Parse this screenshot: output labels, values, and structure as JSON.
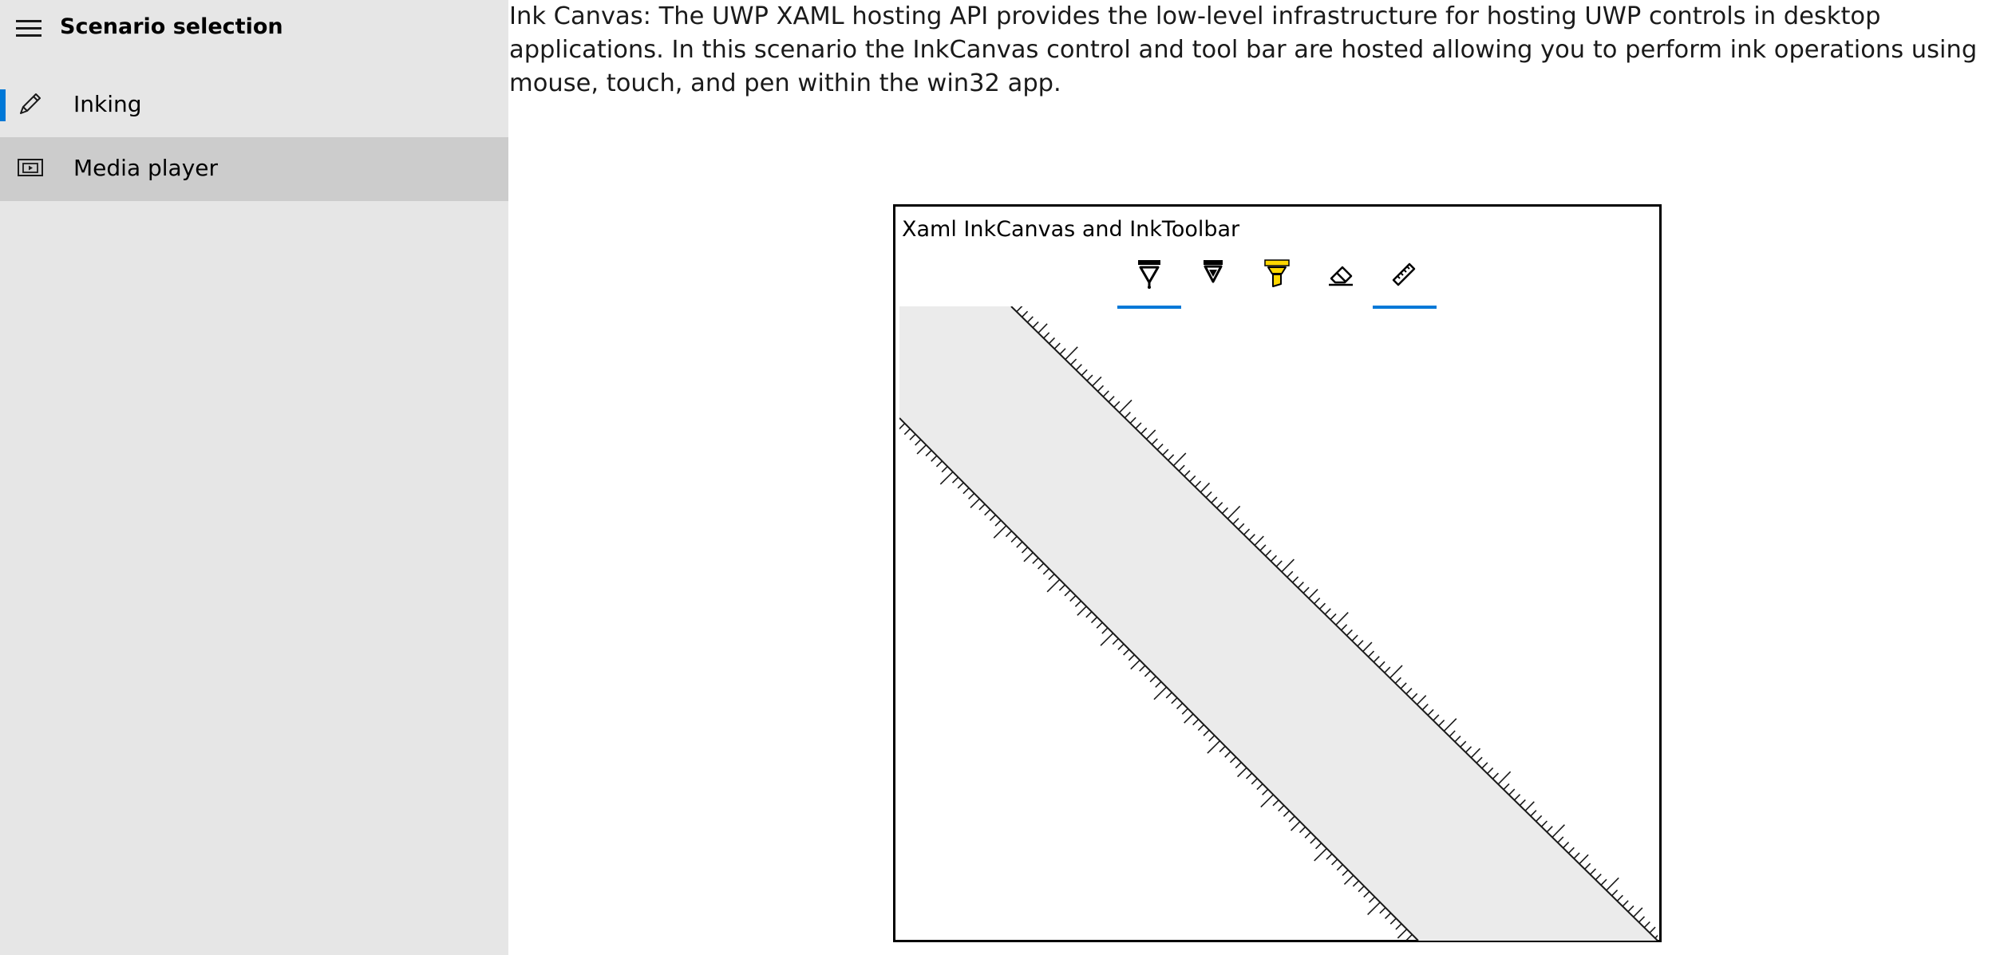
{
  "sidebar": {
    "title": "Scenario selection",
    "items": [
      {
        "label": "Inking",
        "icon": "pencil-icon",
        "selected": true
      },
      {
        "label": "Media player",
        "icon": "media-player-icon",
        "selected": false
      }
    ]
  },
  "main": {
    "description": "Ink Canvas: The UWP XAML hosting API provides the low-level infrastructure for hosting UWP controls in desktop applications. In this scenario the InkCanvas control and tool bar are hosted allowing you to perform ink operations using mouse, touch, and pen within the win32 app.",
    "panel": {
      "title": "Xaml InkCanvas and InkToolbar",
      "tools": [
        {
          "name": "ballpoint-pen",
          "icon": "ballpoint-pen-icon",
          "active": true
        },
        {
          "name": "pencil",
          "icon": "pencil-tool-icon",
          "active": false
        },
        {
          "name": "highlighter",
          "icon": "highlighter-icon",
          "active": false
        },
        {
          "name": "eraser",
          "icon": "eraser-icon",
          "active": false
        },
        {
          "name": "ruler",
          "icon": "ruler-icon",
          "active": true
        }
      ]
    }
  },
  "colors": {
    "accent": "#0078d7",
    "sidebar_bg": "#e6e6e6",
    "hover_bg": "#cccccc",
    "highlighter": "#ffd700",
    "ruler_bg": "#ebebeb"
  }
}
